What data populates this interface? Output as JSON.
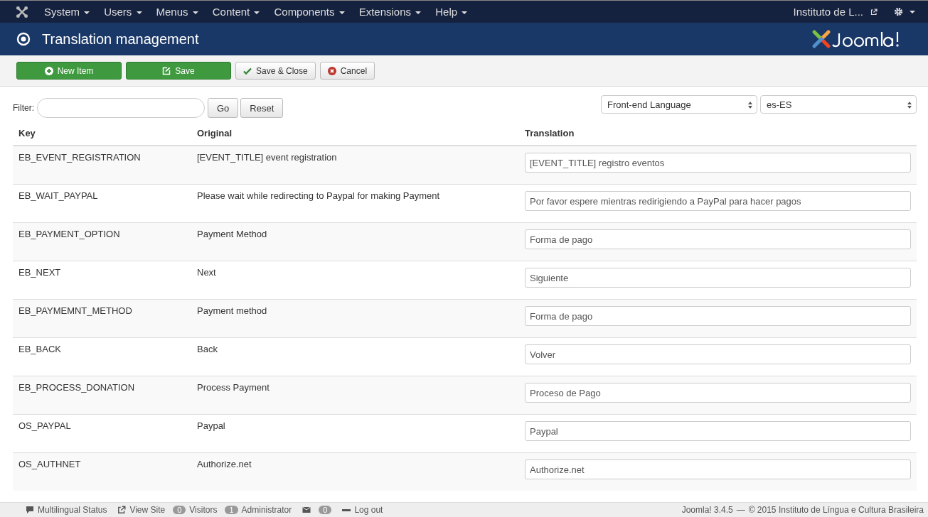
{
  "menu": [
    {
      "label": "System"
    },
    {
      "label": "Users"
    },
    {
      "label": "Menus"
    },
    {
      "label": "Content"
    },
    {
      "label": "Components"
    },
    {
      "label": "Extensions"
    },
    {
      "label": "Help"
    }
  ],
  "site_link": "Instituto de L...",
  "header": {
    "title": "Translation management"
  },
  "toolbar": [
    {
      "label": "New Item",
      "kind": "new"
    },
    {
      "label": "Save",
      "kind": "save"
    },
    {
      "label": "Save & Close",
      "kind": "saveclose"
    },
    {
      "label": "Cancel",
      "kind": "cancel"
    }
  ],
  "filter": {
    "label": "Filter:",
    "go": "Go",
    "reset": "Reset",
    "language_select": "Front-end Language",
    "locale_select": "es-ES"
  },
  "table": {
    "columns": [
      "Key",
      "Original",
      "Translation"
    ],
    "rows": [
      {
        "key": "EB_EVENT_REGISTRATION",
        "original": "[EVENT_TITLE] event registration",
        "translation": "[EVENT_TITLE] registro eventos"
      },
      {
        "key": "EB_WAIT_PAYPAL",
        "original": "Please wait while redirecting to Paypal for making Payment",
        "translation": "Por favor espere mientras redirigiendo a PayPal para hacer pagos"
      },
      {
        "key": "EB_PAYMENT_OPTION",
        "original": "Payment Method",
        "translation": "Forma de pago"
      },
      {
        "key": "EB_NEXT",
        "original": "Next",
        "translation": "Siguiente"
      },
      {
        "key": "EB_PAYMEMNT_METHOD",
        "original": "Payment method",
        "translation": "Forma de pago"
      },
      {
        "key": "EB_BACK",
        "original": "Back",
        "translation": "Volver"
      },
      {
        "key": "EB_PROCESS_DONATION",
        "original": "Process Payment",
        "translation": "Proceso de Pago"
      },
      {
        "key": "OS_PAYPAL",
        "original": "Paypal",
        "translation": "Paypal"
      },
      {
        "key": "OS_AUTHNET",
        "original": "Authorize.net",
        "translation": "Authorize.net"
      }
    ]
  },
  "status_bar": {
    "multilingual": "Multilingual Status",
    "view_site": "View Site",
    "visitors_count": "0",
    "visitors": "Visitors",
    "admin_count": "1",
    "admin": "Administrator",
    "messages_count": "0",
    "logout": "Log out",
    "version": "Joomla! 3.4.5",
    "separator": "—",
    "copyright": "© 2015 Instituto de Língua e Cultura Brasileira"
  }
}
